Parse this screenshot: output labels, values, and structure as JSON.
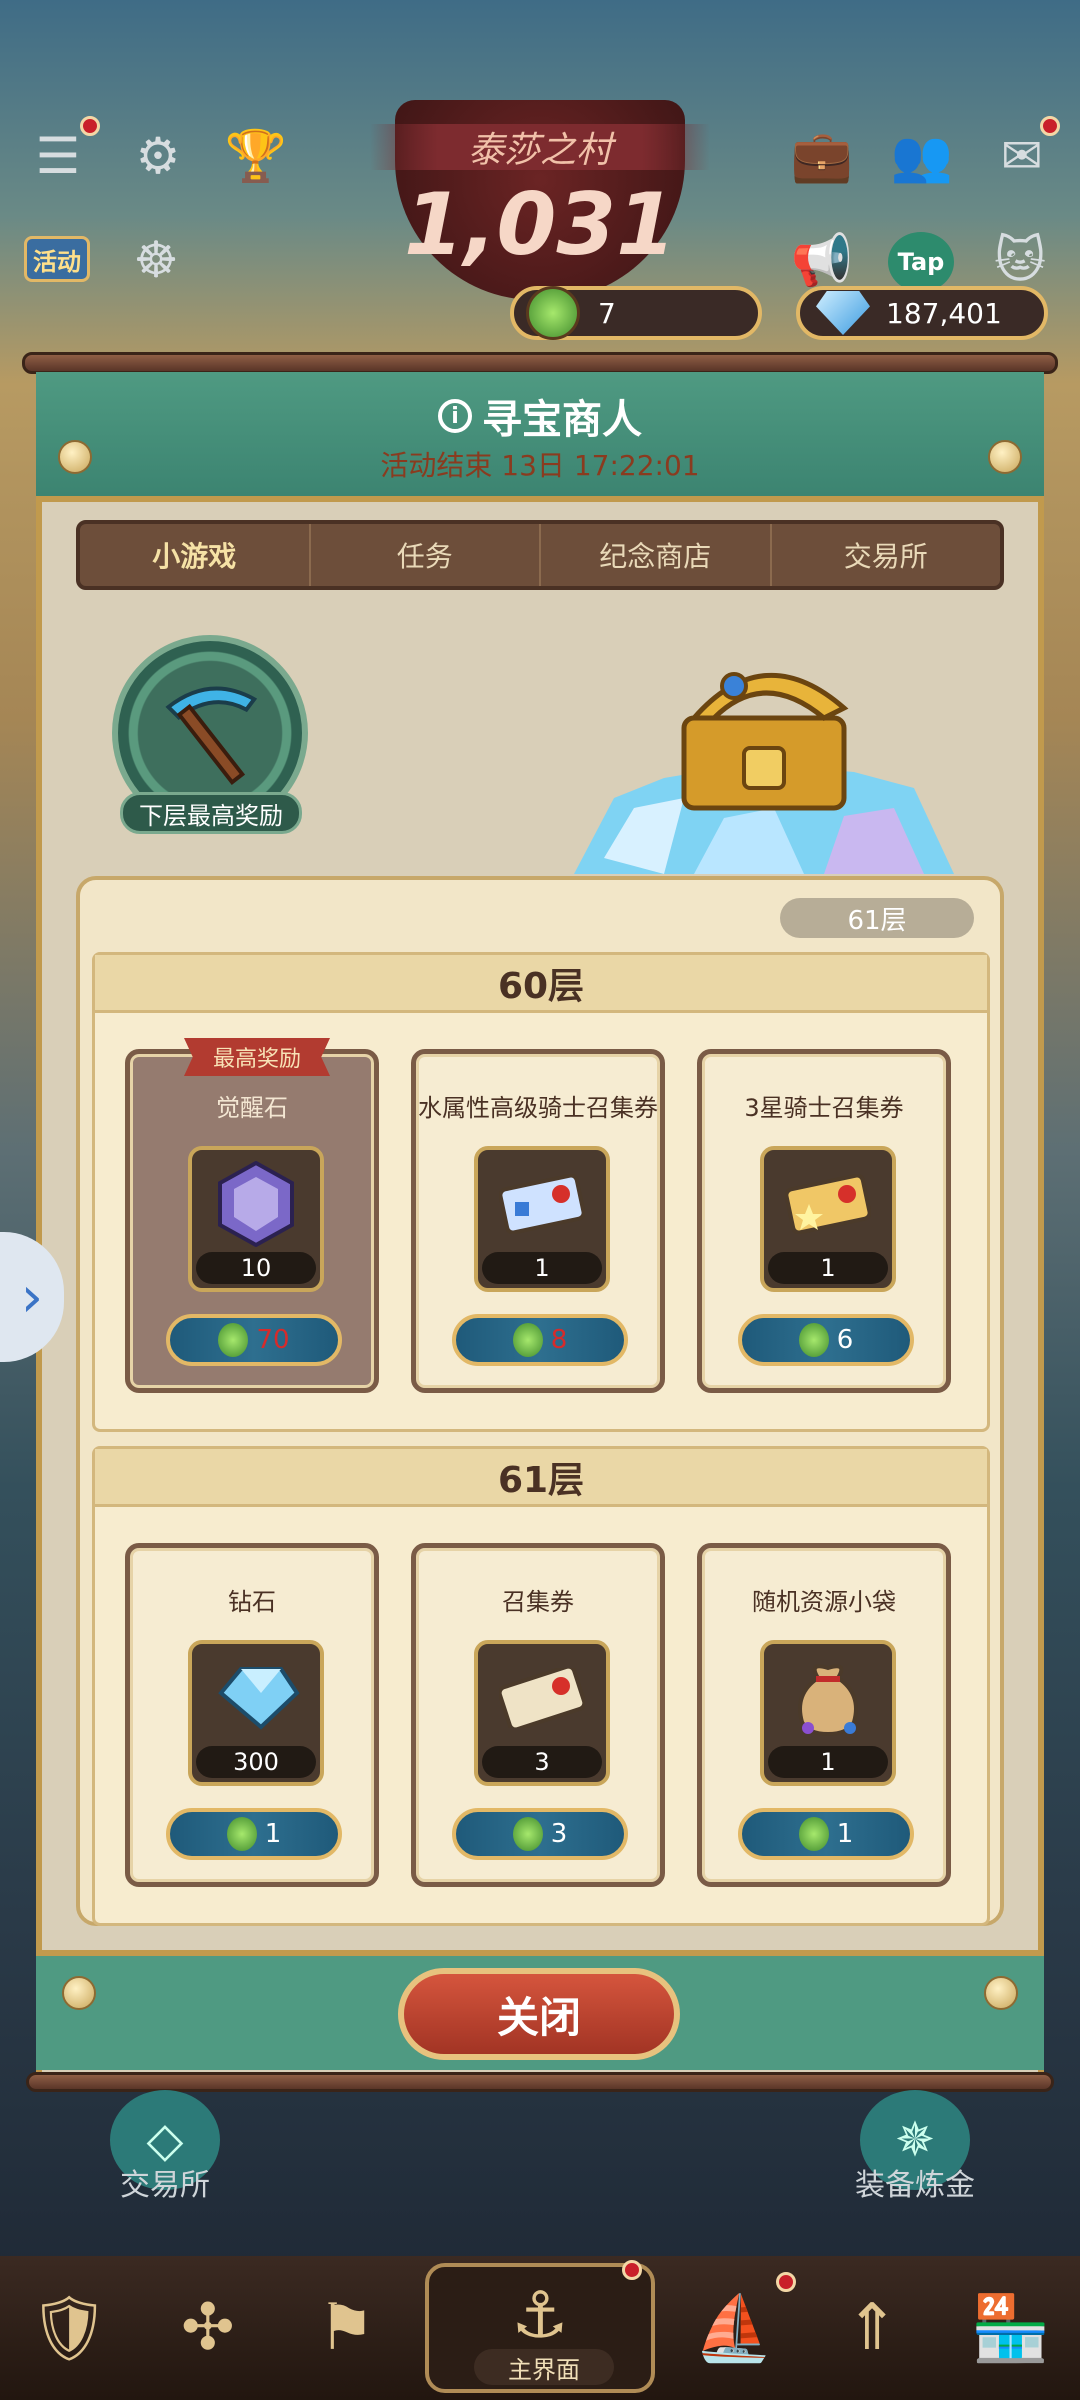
{
  "top_bar": {
    "village_name": "泰莎之村",
    "score": "1,031",
    "green_gem_count": "7",
    "diamond_count": "187,401",
    "event_label": "活动",
    "tap_label": "Tap"
  },
  "panel": {
    "title": "寻宝商人",
    "subtitle": "活动结束 13日 17:22:01",
    "tabs": [
      "小游戏",
      "任务",
      "纪念商店",
      "交易所"
    ],
    "active_tab": 0,
    "badge_label": "下层最高奖励",
    "current_floor": "61层",
    "floors": [
      {
        "name": "60层",
        "items": [
          {
            "title": "觉醒石",
            "count": "10",
            "price": "70",
            "price_red": true,
            "top_reward": "最高奖励"
          },
          {
            "title": "水属性高级骑士召集券",
            "count": "1",
            "price": "8",
            "price_red": true
          },
          {
            "title": "3星骑士召集券",
            "count": "1",
            "price": "6",
            "price_red": false
          }
        ]
      },
      {
        "name": "61层",
        "items": [
          {
            "title": "钻石",
            "count": "300",
            "price": "1",
            "price_red": false
          },
          {
            "title": "召集券",
            "count": "3",
            "price": "3",
            "price_red": false
          },
          {
            "title": "随机资源小袋",
            "count": "1",
            "price": "1",
            "price_red": false
          }
        ]
      }
    ],
    "close_label": "关闭"
  },
  "background": {
    "left_label": "交易所",
    "right_label": "装备炼金"
  },
  "bottom_nav": {
    "home_label": "主界面"
  },
  "colors": {
    "header_green": "#4f9a82",
    "panel_bg": "#d9cfb8",
    "price_red": "#d62b2b"
  }
}
